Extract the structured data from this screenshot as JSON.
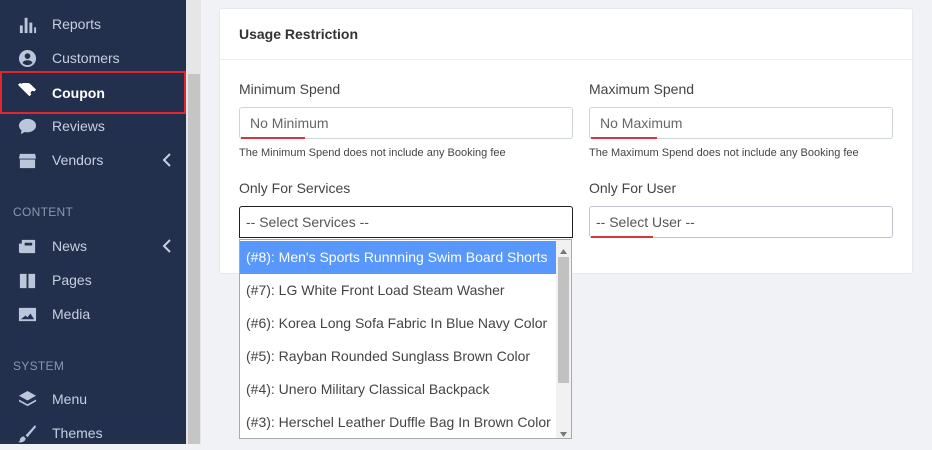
{
  "sidebar": {
    "items": [
      {
        "label": "Reports",
        "icon": "bar-chart-icon"
      },
      {
        "label": "Customers",
        "icon": "user-circle-icon"
      },
      {
        "label": "Coupon",
        "icon": "ticket-icon"
      },
      {
        "label": "Reviews",
        "icon": "comment-icon"
      },
      {
        "label": "Vendors",
        "icon": "store-icon"
      }
    ],
    "content_heading": "CONTENT",
    "content_items": [
      {
        "label": "News",
        "icon": "newspaper-icon"
      },
      {
        "label": "Pages",
        "icon": "book-icon"
      },
      {
        "label": "Media",
        "icon": "image-icon"
      }
    ],
    "system_heading": "SYSTEM",
    "system_items": [
      {
        "label": "Menu",
        "icon": "layers-icon"
      },
      {
        "label": "Themes",
        "icon": "brush-icon"
      }
    ]
  },
  "card": {
    "title": "Usage Restriction",
    "min_spend": {
      "label": "Minimum Spend",
      "placeholder": "No Minimum",
      "help": "The Minimum Spend does not include any Booking fee"
    },
    "max_spend": {
      "label": "Maximum Spend",
      "placeholder": "No Maximum",
      "help": "The Maximum Spend does not include any Booking fee"
    },
    "services": {
      "label": "Only For Services",
      "placeholder": "-- Select Services --"
    },
    "user": {
      "label": "Only For User",
      "placeholder": "-- Select User --"
    }
  },
  "dropdown": {
    "options": [
      "(#8): Men's Sports Runnning Swim Board Shorts",
      "(#7): LG White Front Load Steam Washer",
      "(#6): Korea Long Sofa Fabric In Blue Navy Color",
      "(#5): Rayban Rounded Sunglass Brown Color",
      "(#4): Unero Military Classical Backpack",
      "(#3): Herschel Leather Duffle Bag In Brown Color"
    ],
    "highlighted_color": "#5897fb"
  },
  "colors": {
    "sidebar_bg": "#23304d",
    "active_outline": "#e0272f"
  }
}
